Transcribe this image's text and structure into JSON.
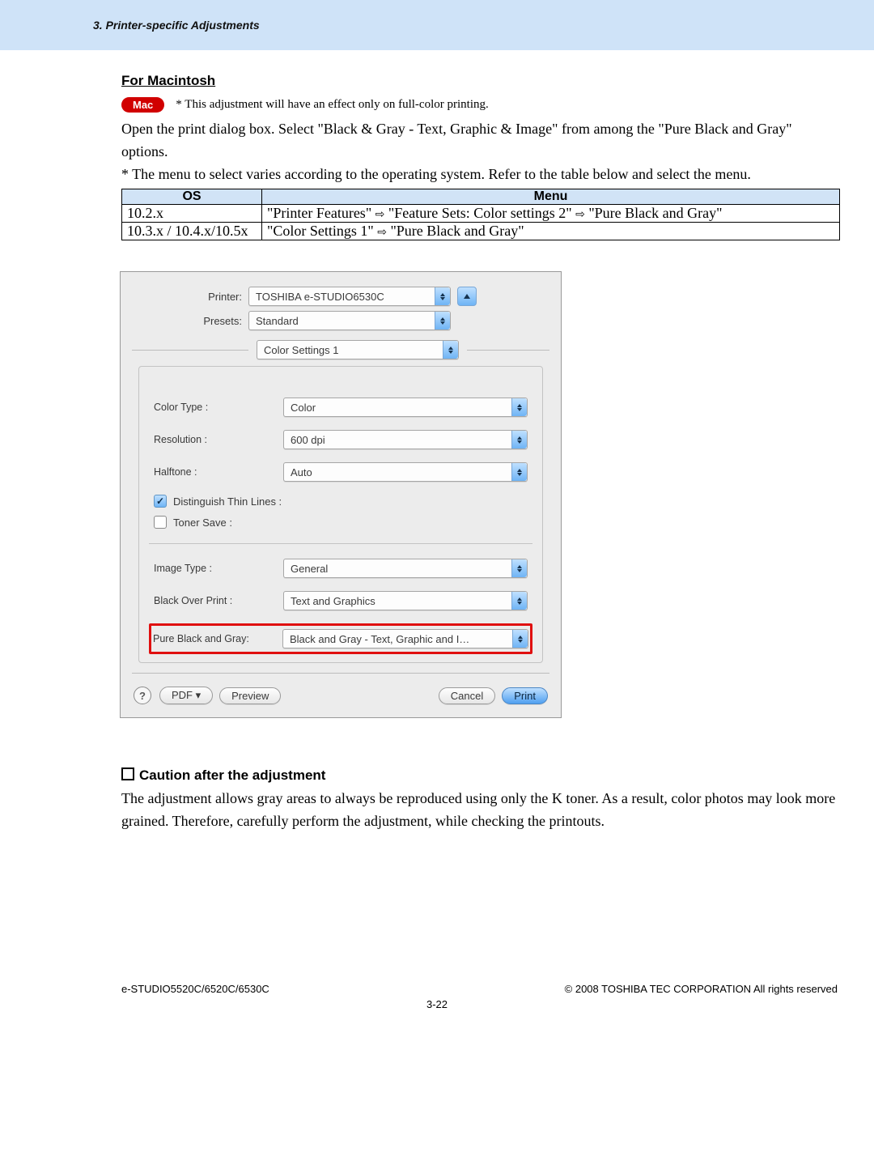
{
  "header": {
    "chapter": "3. Printer-specific Adjustments"
  },
  "section_title": "For Macintosh",
  "mac_badge": "Mac",
  "mac_note": "* This adjustment will have an effect only on full-color printing.",
  "body_para": "Open the print dialog box.  Select \"Black & Gray - Text, Graphic & Image\" from among the \"Pure Black and Gray\" options.",
  "body_note": "* The menu to select varies according to the operating system.  Refer to the table below and select the menu.",
  "os_table": {
    "headers": [
      "OS",
      "Menu"
    ],
    "rows": [
      {
        "os": "10.2.x",
        "menu_parts": [
          "\"Printer Features\"",
          "⇨",
          "\"Feature Sets: Color settings 2\"",
          "⇨",
          "\"Pure Black and Gray\""
        ]
      },
      {
        "os": "10.3.x / 10.4.x/10.5x",
        "menu_parts": [
          "\"Color Settings 1\"",
          "⇨",
          "\"Pure Black and Gray\""
        ]
      }
    ]
  },
  "dialog": {
    "printer_label": "Printer:",
    "printer_value": "TOSHIBA e-STUDIO6530C",
    "presets_label": "Presets:",
    "presets_value": "Standard",
    "pane_select": "Color Settings 1",
    "rows": {
      "color_type": {
        "label": "Color Type :",
        "value": "Color"
      },
      "resolution": {
        "label": "Resolution :",
        "value": "600 dpi"
      },
      "halftone": {
        "label": "Halftone :",
        "value": "Auto"
      },
      "distinguish": {
        "label": "Distinguish Thin Lines :",
        "checked": true
      },
      "toner_save": {
        "label": "Toner Save :",
        "checked": false
      },
      "image_type": {
        "label": "Image Type :",
        "value": "General"
      },
      "black_over": {
        "label": "Black Over Print :",
        "value": "Text and Graphics"
      },
      "pure_black": {
        "label": "Pure Black and Gray:",
        "value": "Black and Gray - Text, Graphic and I…"
      }
    },
    "footer": {
      "pdf": "PDF ▾",
      "preview": "Preview",
      "cancel": "Cancel",
      "print": "Print"
    }
  },
  "caution_title": "Caution after the adjustment",
  "caution_body": "The adjustment allows gray areas to always be reproduced using only the K toner.  As a result, color photos may look more grained.  Therefore, carefully perform the adjustment, while checking the printouts.",
  "footer": {
    "left": "e-STUDIO5520C/6520C/6530C",
    "right": "© 2008 TOSHIBA TEC CORPORATION All rights reserved",
    "page": "3-22"
  }
}
